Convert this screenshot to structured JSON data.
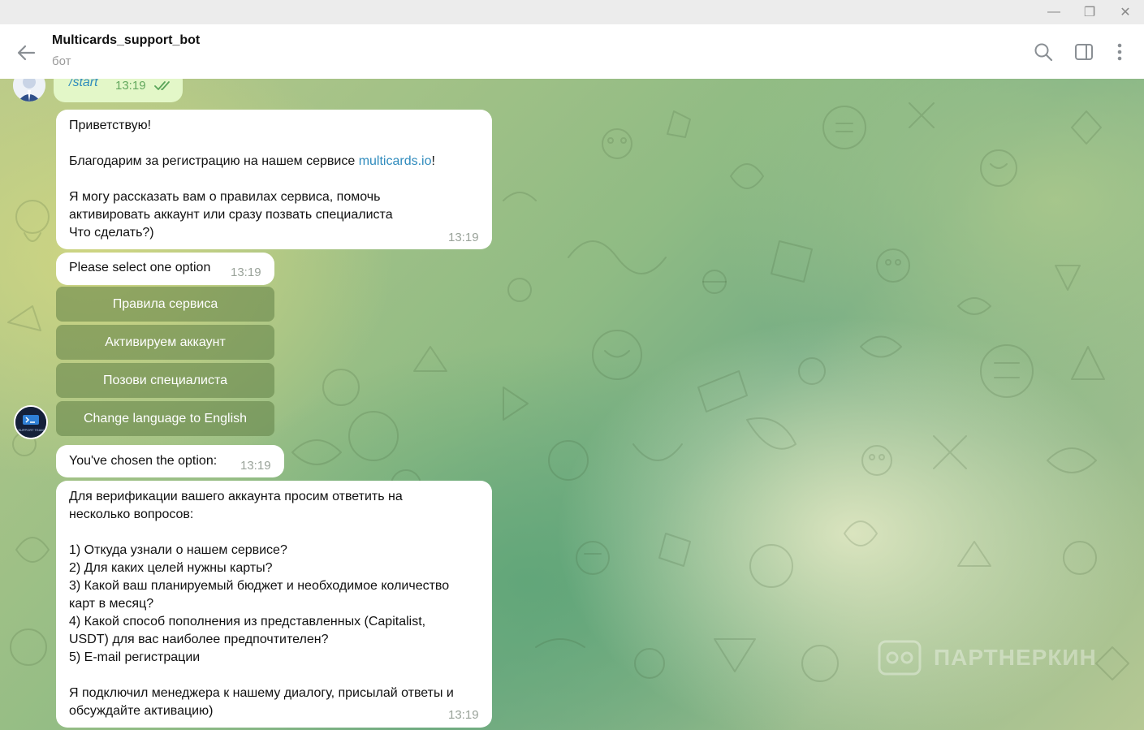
{
  "window": {
    "minimize_glyph": "—",
    "maximize_glyph": "❐",
    "close_glyph": "✕"
  },
  "header": {
    "title": "Multicards_support_bot",
    "subtitle": "бот",
    "icons": [
      "back-arrow-icon",
      "search-icon",
      "sidebar-toggle-icon",
      "more-vertical-icon"
    ]
  },
  "messages": {
    "start": {
      "text": "/start",
      "time": "13:19",
      "status": "read"
    },
    "greeting": {
      "line1": "Приветствую!",
      "line2_prefix": "Благодарим за регистрацию на нашем сервисе ",
      "line2_link": "multicards.io",
      "line2_suffix": "!",
      "line3": "Я могу рассказать вам о правилах сервиса, помочь",
      "line4": "активировать аккаунт или сразу позвать специалиста",
      "line5": "Что сделать?)",
      "time": "13:19"
    },
    "select": {
      "text": "Please select one option",
      "time": "13:19"
    },
    "keyboard": [
      "Правила сервиса",
      "Активируем аккаунт",
      "Позови специалиста",
      "Change language to English"
    ],
    "chosen": {
      "text": "You've chosen the option:",
      "time": "13:19"
    },
    "verification": {
      "lines": [
        "Для верификации вашего аккаунта просим ответить на",
        "несколько вопросов:",
        "",
        "1) Откуда узнали о нашем сервисе?",
        "2) Для каких целей нужны карты?",
        "3) Какой ваш планируемый бюджет и необходимое количество",
        "карт в месяц?",
        "4) Какой способ пополнения из представленных (Capitalist,",
        "USDT) для вас наиболее предпочтителен?",
        "5) E-mail регистрации",
        "",
        "Я подключил менеджера к нашему диалогу, присылай ответы и",
        "обсуждайте активацию)"
      ],
      "time": "13:19"
    }
  },
  "bot_avatar": {
    "caption": "SUPPORT TEAM"
  },
  "watermark": {
    "text": "ПАРТНЕРКИН"
  },
  "colors": {
    "link": "#2f8bbd",
    "outgoing_bubble": "#e3f7c8",
    "header_bg": "#ffffff",
    "keyboard_button": "#7a9a5c"
  }
}
